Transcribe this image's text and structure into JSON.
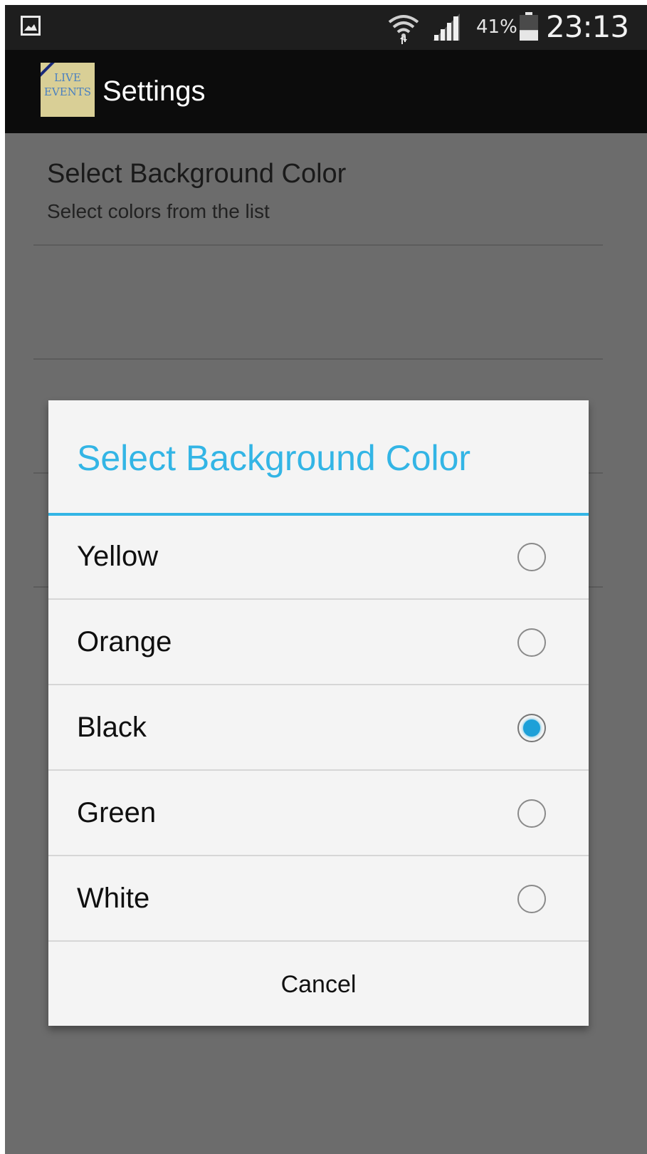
{
  "status_bar": {
    "icons": [
      "gallery-icon",
      "wifi-icon",
      "signal-icon",
      "battery-icon"
    ],
    "battery_percent": "41%",
    "battery_level": 0.41,
    "time": "23:13"
  },
  "action_bar": {
    "logo_line1": "LIVE",
    "logo_line2": "EVENTS",
    "title": "Settings"
  },
  "preference": {
    "title": "Select Background Color",
    "summary": "Select colors from the list"
  },
  "dialog": {
    "title": "Select Background Color",
    "accent_color": "#33b5e5",
    "options": [
      {
        "label": "Yellow",
        "checked": false
      },
      {
        "label": "Orange",
        "checked": false
      },
      {
        "label": "Black",
        "checked": true
      },
      {
        "label": "Green",
        "checked": false
      },
      {
        "label": "White",
        "checked": false
      }
    ],
    "cancel_label": "Cancel"
  }
}
